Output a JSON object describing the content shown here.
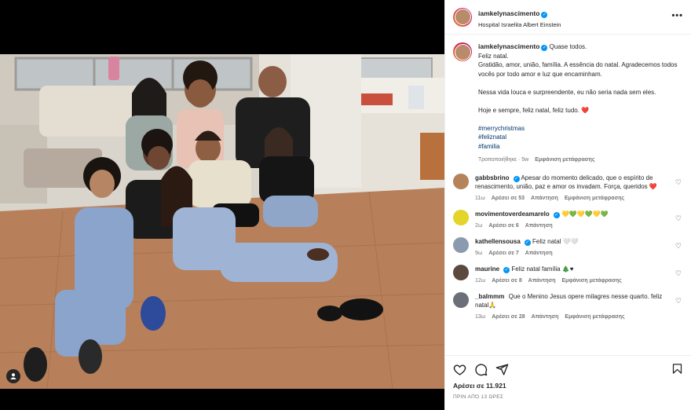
{
  "post": {
    "username": "iamkelynascimento",
    "location": "Hospital Israelita Albert Einstein",
    "more_label": "•••",
    "caption": {
      "lead": "Quase todos.",
      "lines": [
        "Feliz natal.",
        "Gratidão, amor, união, família. A essência do natal. Agradecemos todos vocês por todo amor e luz que encaminham."
      ],
      "line2": "Nessa vida louca e surpreendente, eu não seria nada sem eles.",
      "line3": "Hoje e sempre, feliz natal, feliz tudo. ❤️",
      "hashtags": [
        "#merrychristmas",
        "#feliznatal",
        "#familia"
      ]
    },
    "caption_meta": {
      "edited": "Τροποποιήθηκε · 5w",
      "translate": "Εμφάνιση μετάφρασης"
    }
  },
  "comments": [
    {
      "user": "gabbsbrino",
      "verified": true,
      "text": "Apesar do momento delicado, que o espírito de renascimento, união, paz e amor os invadam. Força, queridos ❤️",
      "age": "11ω",
      "likes": "Αρέσει σε 53",
      "reply": "Απάντηση",
      "translate": "Εμφάνιση μετάφρασης",
      "avatar_color": "#b5835a"
    },
    {
      "user": "movimentoverdeamarelo",
      "verified": true,
      "text": "💛💚💛💚💛💚",
      "age": "2ω",
      "likes": "Αρέσει σε 6",
      "reply": "Απάντηση",
      "translate": "",
      "avatar_color": "#e3d52a"
    },
    {
      "user": "kathellensousa",
      "verified": true,
      "text": "Feliz natal 🤍🤍",
      "age": "9ω",
      "likes": "Αρέσει σε 7",
      "reply": "Απάντηση",
      "translate": "",
      "avatar_color": "#8a9bb0"
    },
    {
      "user": "maurine",
      "verified": true,
      "text": "Feliz natal família 🎄♥",
      "age": "12ω",
      "likes": "Αρέσει σε 8",
      "reply": "Απάντηση",
      "translate": "Εμφάνιση μετάφρασης",
      "avatar_color": "#5c4a3e"
    },
    {
      "user": "_balmmm",
      "verified": false,
      "text": "Que o Menino Jesus opere milagres nesse quarto. feliz natal🙏",
      "age": "13ω",
      "likes": "Αρέσει σε 28",
      "reply": "Απάντηση",
      "translate": "Εμφάνιση μετάφρασης",
      "avatar_color": "#6b6f78"
    }
  ],
  "footer": {
    "likes_label": "Αρέσει σε 11.921",
    "posted": "ΠΡΙΝ ΑΠΌ 13 ΩΡΕΣ"
  },
  "colors": {
    "link": "#00376b",
    "verified": "#0095f6",
    "muted": "#737373"
  }
}
